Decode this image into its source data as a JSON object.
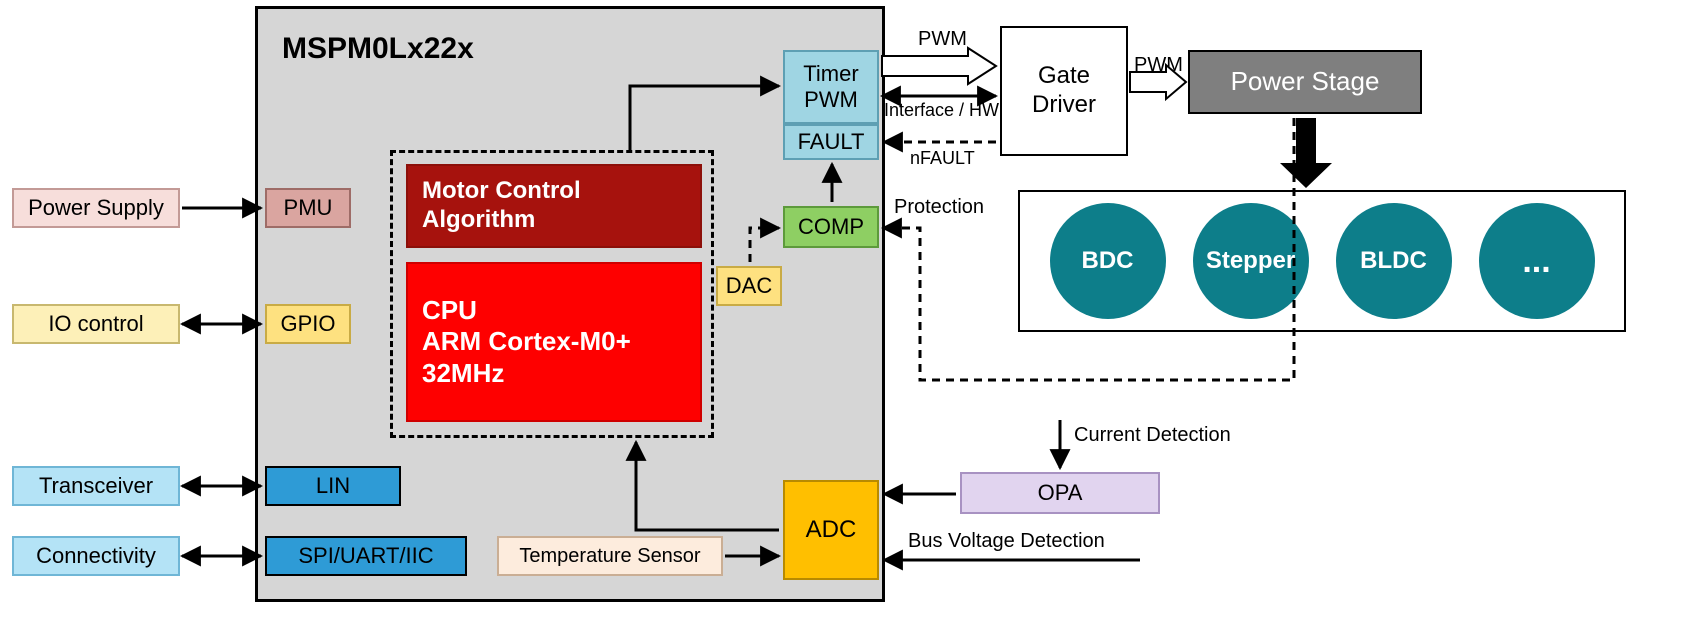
{
  "chipTitle": "MSPM0Lx22x",
  "external": {
    "powerSupply": "Power Supply",
    "ioControl": "IO control",
    "transceiver": "Transceiver",
    "connectivity": "Connectivity"
  },
  "mcu": {
    "pmu": "PMU",
    "gpio": "GPIO",
    "lin": "LIN",
    "spi": "SPI/UART/IIC",
    "timerPwm": "Timer\nPWM",
    "fault": "FAULT",
    "comp": "COMP",
    "dac": "DAC",
    "adc": "ADC",
    "tempSensor": "Temperature Sensor",
    "motorAlg": "Motor Control\nAlgorithm",
    "cpu": "CPU\nARM Cortex-M0+\n32MHz"
  },
  "right": {
    "gateDriver": "Gate\nDriver",
    "powerStage": "Power Stage",
    "opa": "OPA"
  },
  "motorTypes": [
    "BDC",
    "Stepper",
    "BLDC",
    "..."
  ],
  "labels": {
    "pwmTop": "PWM",
    "pwmRight": "PWM",
    "interfaceHw": "Interface / HW",
    "nfault": "nFAULT",
    "protection": "Protection",
    "currentDetection": "Current  Detection",
    "busVoltage": "Bus Voltage  Detection"
  }
}
